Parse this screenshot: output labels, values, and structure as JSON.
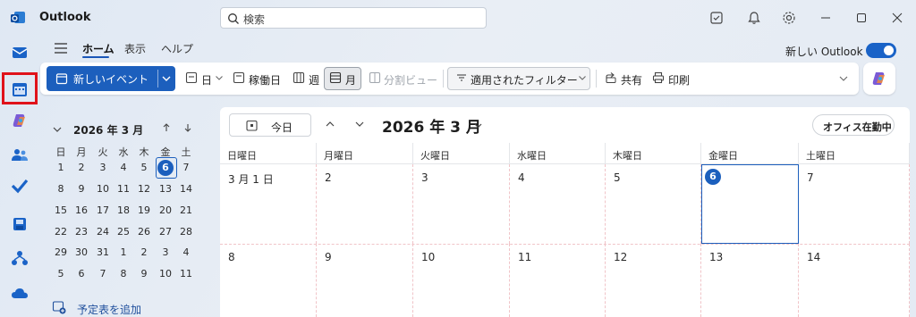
{
  "app": {
    "title": "Outlook"
  },
  "search": {
    "placeholder": "検索"
  },
  "ribbon_tabs": [
    {
      "label": "ホーム"
    },
    {
      "label": "表示"
    },
    {
      "label": "ヘルプ"
    }
  ],
  "new_outlook": {
    "label": "新しい Outlook",
    "enabled": true
  },
  "toolbar": {
    "new_event": "新しいイベント",
    "day": "日",
    "work_week": "稼働日",
    "week": "週",
    "month": "月",
    "split_view": "分割ビュー",
    "filter": "適用されたフィルター",
    "share": "共有",
    "print": "印刷"
  },
  "minical": {
    "title": "2026 年 3 月",
    "weekdays": [
      "日",
      "月",
      "火",
      "水",
      "木",
      "金",
      "土"
    ],
    "weeks": [
      [
        "1",
        "2",
        "3",
        "4",
        "5",
        "6",
        "7"
      ],
      [
        "8",
        "9",
        "10",
        "11",
        "12",
        "13",
        "14"
      ],
      [
        "15",
        "16",
        "17",
        "18",
        "19",
        "20",
        "21"
      ],
      [
        "22",
        "23",
        "24",
        "25",
        "26",
        "27",
        "28"
      ],
      [
        "29",
        "30",
        "31",
        "1",
        "2",
        "3",
        "4"
      ],
      [
        "5",
        "6",
        "7",
        "8",
        "9",
        "10",
        "11"
      ]
    ],
    "today": "6",
    "add_calendar": "予定表を追加"
  },
  "main": {
    "today_button": "今日",
    "month_title": "2026 年 3 月",
    "office_status": "オフィス在勤中",
    "weekday_headers": [
      "日曜日",
      "月曜日",
      "火曜日",
      "水曜日",
      "木曜日",
      "金曜日",
      "土曜日"
    ],
    "rows": [
      [
        "3 月 1 日",
        "2",
        "3",
        "4",
        "5",
        "6",
        "7"
      ],
      [
        "8",
        "9",
        "10",
        "11",
        "12",
        "13",
        "14"
      ]
    ],
    "today": "6"
  },
  "colors": {
    "accent": "#1c5fbd",
    "highlight_box": "#e0121a"
  },
  "icons": {
    "rail": [
      "mail-icon",
      "calendar-icon",
      "copilot-icon",
      "people-icon",
      "todo-icon",
      "onedrive-save-icon",
      "org-icon",
      "cloud-icon"
    ]
  }
}
